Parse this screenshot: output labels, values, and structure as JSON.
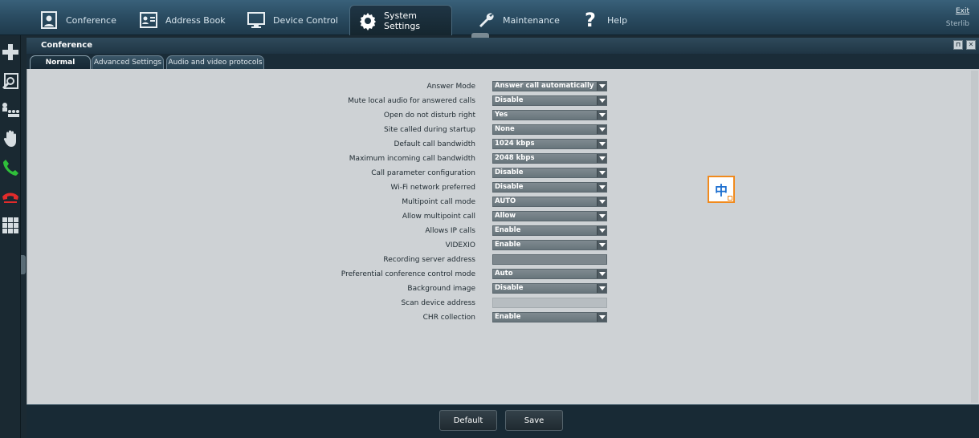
{
  "nav": {
    "items": [
      {
        "label": "Conference",
        "icon": "conference-icon"
      },
      {
        "label": "Address Book",
        "icon": "address-book-icon"
      },
      {
        "label": "Device Control",
        "icon": "monitor-icon"
      },
      {
        "label": "System Settings",
        "icon": "gear-icon"
      },
      {
        "label": "Maintenance",
        "icon": "wrench-icon"
      },
      {
        "label": "Help",
        "icon": "question-icon"
      }
    ],
    "active": "System Settings",
    "exit_label": "Exit",
    "user": "Sterlib"
  },
  "sidebar": {
    "icons": [
      "add-icon",
      "search-user-icon",
      "participants-icon",
      "hand-icon",
      "call-icon",
      "hangup-icon",
      "grid-icon"
    ]
  },
  "panel": {
    "title": "Conference",
    "tabs": [
      "Normal",
      "Advanced Settings",
      "Audio and video protocols"
    ],
    "active_tab": "Normal"
  },
  "form": {
    "rows": [
      {
        "label": "Answer Mode",
        "value": "Answer call automatically",
        "type": "select"
      },
      {
        "label": "Mute local audio for answered calls",
        "value": "Disable",
        "type": "select"
      },
      {
        "label": "Open do not disturb right",
        "value": "Yes",
        "type": "select"
      },
      {
        "label": "Site called during startup",
        "value": "None",
        "type": "select"
      },
      {
        "label": "Default call bandwidth",
        "value": "1024 kbps",
        "type": "select"
      },
      {
        "label": "Maximum incoming call bandwidth",
        "value": "2048 kbps",
        "type": "select"
      },
      {
        "label": "Call parameter configuration",
        "value": "Disable",
        "type": "select"
      },
      {
        "label": "Wi-Fi network preferred",
        "value": "Disable",
        "type": "select"
      },
      {
        "label": "Multipoint call mode",
        "value": "AUTO",
        "type": "select"
      },
      {
        "label": "Allow multipoint call",
        "value": "Allow",
        "type": "select"
      },
      {
        "label": "Allows IP calls",
        "value": "Enable",
        "type": "select"
      },
      {
        "label": "VIDEXIO",
        "value": "Enable",
        "type": "select"
      },
      {
        "label": "Recording server address",
        "value": "",
        "type": "input"
      },
      {
        "label": "Preferential conference control mode",
        "value": "Auto",
        "type": "select"
      },
      {
        "label": "Background image",
        "value": "Disable",
        "type": "select"
      },
      {
        "label": "Scan device address",
        "value": "",
        "type": "input-disabled"
      },
      {
        "label": "CHR collection",
        "value": "Enable",
        "type": "select"
      }
    ]
  },
  "ime": {
    "char": "中"
  },
  "footer": {
    "default_label": "Default",
    "save_label": "Save"
  }
}
